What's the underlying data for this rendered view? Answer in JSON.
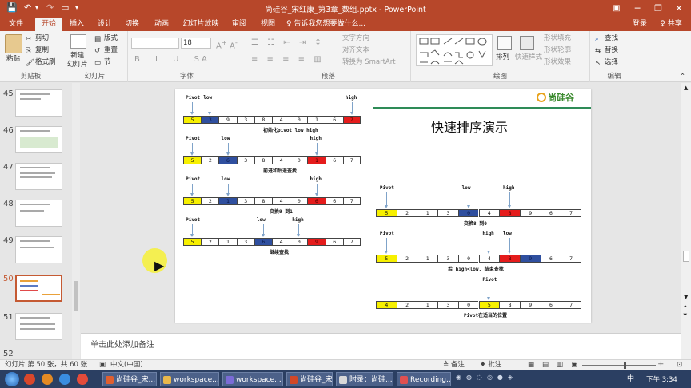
{
  "window": {
    "title": "尚硅谷_宋红康_第3章_数组.pptx - PowerPoint"
  },
  "tabs": [
    {
      "label": "文件"
    },
    {
      "label": "开始"
    },
    {
      "label": "插入"
    },
    {
      "label": "设计"
    },
    {
      "label": "切换"
    },
    {
      "label": "动画"
    },
    {
      "label": "幻灯片放映"
    },
    {
      "label": "审阅"
    },
    {
      "label": "视图"
    }
  ],
  "tellme": "♀ 告诉我您想要做什么...",
  "account": {
    "login": "登录",
    "share": "♀ 共享"
  },
  "ribbon": {
    "clipboard": {
      "paste": "粘贴",
      "cut": "剪切",
      "copy": "复制",
      "painter": "格式刷",
      "label": "剪贴板"
    },
    "slides": {
      "new": "新建\n幻灯片",
      "layout": "版式",
      "reset": "重置",
      "section": "节",
      "label": "幻灯片"
    },
    "font": {
      "size": "18",
      "label": "字体"
    },
    "paragraph": {
      "direction": "文字方向",
      "align": "对齐文本",
      "smartart": "转换为 SmartArt",
      "label": "段落"
    },
    "drawing": {
      "arrange": "排列",
      "quickstyle": "快速样式",
      "fill": "形状填充",
      "outline": "形状轮廓",
      "effect": "形状效果",
      "label": "绘图"
    },
    "editing": {
      "find": "查找",
      "replace": "替换",
      "select": "选择",
      "label": "编辑"
    }
  },
  "thumbs": [
    {
      "num": "45"
    },
    {
      "num": "46"
    },
    {
      "num": "47"
    },
    {
      "num": "48"
    },
    {
      "num": "49"
    },
    {
      "num": "50"
    },
    {
      "num": "51"
    },
    {
      "num": "52"
    }
  ],
  "slide": {
    "title": "快速排序演示",
    "logo": "尚硅谷",
    "row1": {
      "cells": [
        "5",
        "3",
        "9",
        "3",
        "8",
        "4",
        "0",
        "1",
        "6",
        "7"
      ],
      "labels": [
        "Pivot",
        "low",
        "high"
      ],
      "caption": "初始化pivot low high"
    },
    "row2": {
      "cells": [
        "5",
        "2",
        "6",
        "3",
        "8",
        "4",
        "0",
        "1",
        "6",
        "7"
      ],
      "labels": [
        "Pivot",
        "low",
        "high"
      ],
      "caption": "前进和后退查找"
    },
    "row3": {
      "cells": [
        "5",
        "2",
        "1",
        "3",
        "8",
        "4",
        "0",
        "6",
        "6",
        "7"
      ],
      "labels": [
        "Pivot",
        "low",
        "high"
      ],
      "caption": "交换9 到1"
    },
    "row4": {
      "cells": [
        "5",
        "2",
        "1",
        "3",
        "6",
        "4",
        "0",
        "9",
        "6",
        "7"
      ],
      "labels": [
        "Pivot",
        "low",
        "high"
      ],
      "caption": "继续查找"
    },
    "row5": {
      "cells": [
        "5",
        "2",
        "1",
        "3",
        "0",
        "4",
        "8",
        "9",
        "6",
        "7"
      ],
      "labels": [
        "Pivot",
        "low",
        "high"
      ],
      "caption": "交换8 到0"
    },
    "row6": {
      "cells": [
        "5",
        "2",
        "1",
        "3",
        "0",
        "4",
        "8",
        "9",
        "6",
        "7"
      ],
      "labels": [
        "Pivot",
        "high",
        "low"
      ],
      "caption": "若 high<low, 结束查找"
    },
    "row7": {
      "cells": [
        "4",
        "2",
        "1",
        "3",
        "0",
        "5",
        "8",
        "9",
        "6",
        "7"
      ],
      "labels": [
        "Pivot"
      ],
      "caption": "Pivot在适当的位置"
    }
  },
  "notes": {
    "placeholder": "单击此处添加备注"
  },
  "status": {
    "slide": "幻灯片 第 50 张，共 60 张",
    "lang": "中文(中国)",
    "notes": "≜ 备注",
    "comments": "♦ 批注",
    "zoom_minus": "－",
    "zoom_plus": "＋"
  },
  "taskbar": [
    {
      "label": "尚硅谷_宋..."
    },
    {
      "label": "workspace..."
    },
    {
      "label": "workspace..."
    },
    {
      "label": "尚硅谷_宋..."
    },
    {
      "label": "附录：尚硅..."
    },
    {
      "label": "Recording..."
    }
  ],
  "tray": {
    "time": "下午 3:34",
    "ime": "中"
  },
  "colors": {
    "accent": "#b7472a",
    "pivot": "#f7f000",
    "low": "#2f4f9f",
    "high": "#e51c1c"
  }
}
